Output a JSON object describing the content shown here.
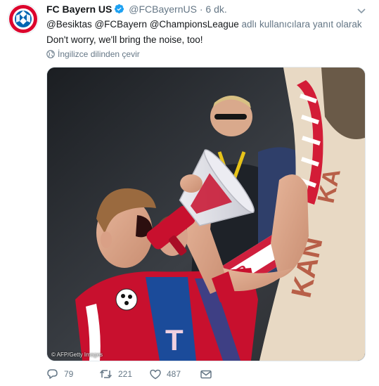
{
  "tweet": {
    "account_name": "FC Bayern US",
    "handle": "@FCBayernUS",
    "separator": "·",
    "time": "6 dk.",
    "reply_mentions": "@Besiktas @FCBayern @ChampionsLeague",
    "reply_suffix": "adlı kullanıcılara yanıt olarak",
    "text": "Don't worry, we'll bring the noise, too!",
    "translate_label": "İngilizce dilinden çevir",
    "image_credit": "© AFP/Getty Images",
    "jersey_text": "T",
    "icons": {
      "avatar": "fc-bayern-logo",
      "verified": "verified-badge-icon",
      "menu": "chevron-down-icon",
      "translate": "globe-icon",
      "reply": "reply-icon",
      "retweet": "retweet-icon",
      "like": "heart-icon",
      "dm": "envelope-icon"
    }
  },
  "actions": {
    "reply_count": "79",
    "retweet_count": "221",
    "like_count": "487"
  },
  "colors": {
    "accent": "#1da1f2",
    "bayern_red": "#dc052d",
    "bayern_blue": "#0066b2",
    "muted_text": "#657786"
  }
}
